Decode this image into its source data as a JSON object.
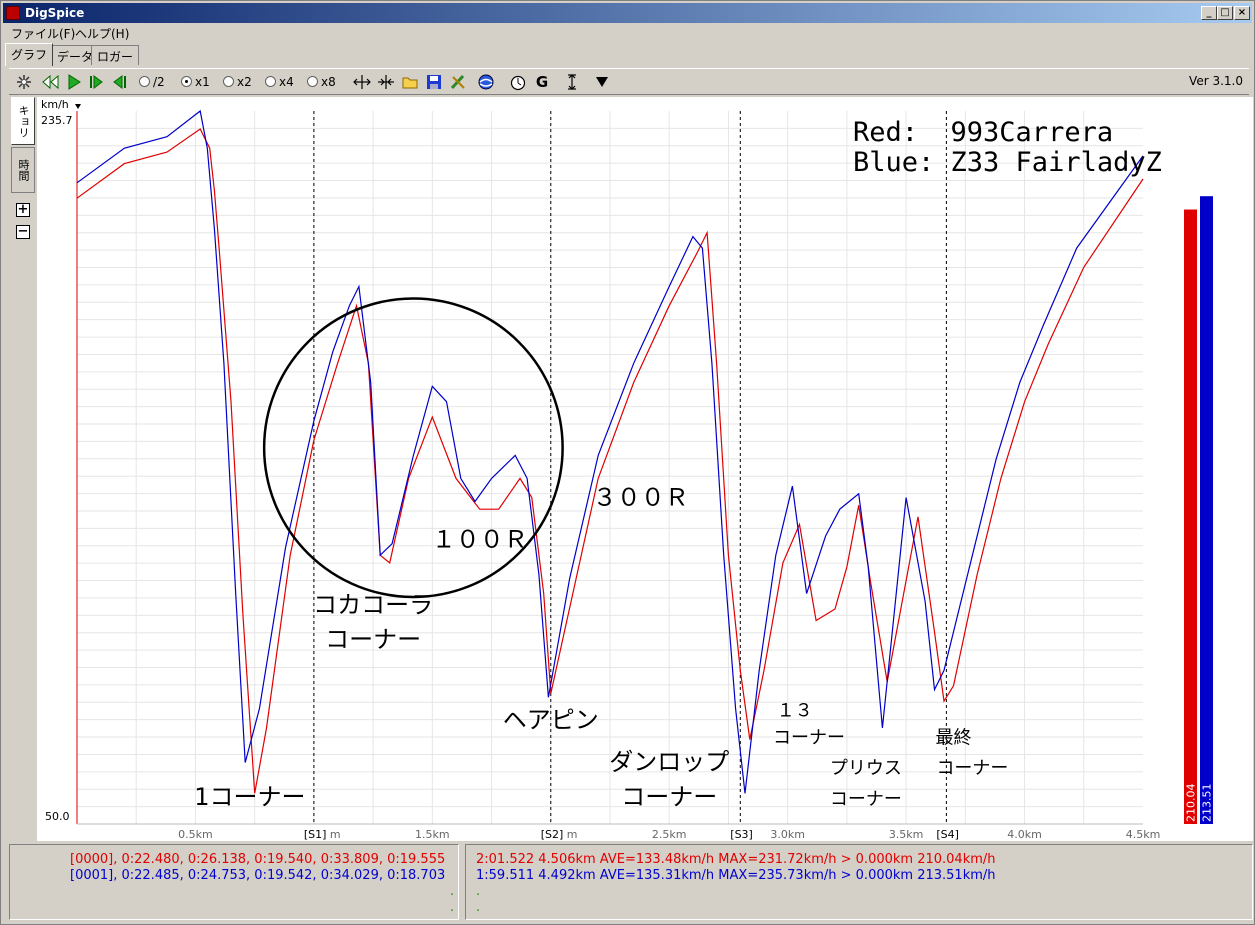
{
  "window": {
    "title": "DigSpice",
    "minimize": "_",
    "maximize": "□",
    "close": "×"
  },
  "menu": [
    {
      "label": "ファイル(F)"
    },
    {
      "label": "ヘルプ(H)"
    }
  ],
  "tabs": [
    {
      "label": "グラフ"
    },
    {
      "label": "データ"
    },
    {
      "label": "ロガー"
    }
  ],
  "toolbar": {
    "speeds": [
      {
        "label": "/2",
        "selected": false
      },
      {
        "label": "x1",
        "selected": true
      },
      {
        "label": "x2",
        "selected": false
      },
      {
        "label": "x4",
        "selected": false
      },
      {
        "label": "x8",
        "selected": false
      }
    ],
    "g_label": "G",
    "version": "Ver 3.1.0"
  },
  "side_tabs": [
    {
      "label": "キョリ"
    },
    {
      "label": "時間"
    }
  ],
  "colors": {
    "red": "#e00000",
    "blue": "#0000c8",
    "accent": "#0a246a"
  },
  "chart_data": {
    "type": "line",
    "ylabel": "km/h",
    "ymax_label": "235.7",
    "ymin_label": "50.0",
    "ylim": [
      50.0,
      235.7
    ],
    "xlim": [
      0,
      4.5
    ],
    "x_unit": "km",
    "x_ticks": [
      {
        "x": 0.5,
        "label": "0.5km"
      },
      {
        "x": 1.5,
        "label": "1.5km"
      },
      {
        "x": 2.5,
        "label": "2.5km"
      },
      {
        "x": 3.0,
        "label": "3.0km"
      },
      {
        "x": 3.5,
        "label": "3.5km"
      },
      {
        "x": 4.0,
        "label": "4.0km"
      },
      {
        "x": 4.5,
        "label": "4.5km"
      }
    ],
    "sectors": [
      {
        "x": 1.0,
        "label": "[S1]",
        "unit": "m"
      },
      {
        "x": 2.0,
        "label": "[S2]",
        "unit": "m"
      },
      {
        "x": 2.8,
        "label": "[S3]",
        "unit": ""
      },
      {
        "x": 3.67,
        "label": "[S4]",
        "unit": ""
      }
    ],
    "legend": [
      "Red:  993Carrera",
      "Blue: Z33 FairladyZ"
    ],
    "annotations": [
      {
        "text": "1コーナー",
        "x": 0.73,
        "y": 55
      },
      {
        "text": "コカコーラ",
        "x": 1.25,
        "y": 105
      },
      {
        "text": "コーナー",
        "x": 1.25,
        "y": 96
      },
      {
        "text": "１００Ｒ",
        "x": 1.7,
        "y": 122
      },
      {
        "text": "３００Ｒ",
        "x": 2.38,
        "y": 133
      },
      {
        "text": "ヘアピン",
        "x": 2.0,
        "y": 75
      },
      {
        "text": "ダンロップ",
        "x": 2.5,
        "y": 64
      },
      {
        "text": "コーナー",
        "x": 2.5,
        "y": 55
      },
      {
        "text": "１３",
        "x": 3.03,
        "y": 78
      },
      {
        "text": "コーナー",
        "x": 3.09,
        "y": 71
      },
      {
        "text": "プリウス",
        "x": 3.33,
        "y": 63
      },
      {
        "text": "コーナー",
        "x": 3.33,
        "y": 55
      },
      {
        "text": "最終",
        "x": 3.7,
        "y": 71
      },
      {
        "text": "コーナー",
        "x": 3.78,
        "y": 63
      }
    ],
    "highlight_circle": {
      "cx": 1.42,
      "cy": 148,
      "r_km": 0.63
    },
    "series": [
      {
        "name": "Red:  993Carrera",
        "color": "#e00000",
        "bar_label": "210.04",
        "bar_value": 210.04,
        "points": [
          [
            0,
            213
          ],
          [
            0.2,
            222
          ],
          [
            0.38,
            225
          ],
          [
            0.52,
            231
          ],
          [
            0.56,
            226
          ],
          [
            0.58,
            215
          ],
          [
            0.6,
            200
          ],
          [
            0.65,
            160
          ],
          [
            0.7,
            105
          ],
          [
            0.75,
            58
          ],
          [
            0.8,
            75
          ],
          [
            0.9,
            120
          ],
          [
            1.0,
            150
          ],
          [
            1.1,
            170
          ],
          [
            1.18,
            185
          ],
          [
            1.23,
            170
          ],
          [
            1.28,
            120
          ],
          [
            1.32,
            118
          ],
          [
            1.4,
            140
          ],
          [
            1.5,
            156
          ],
          [
            1.6,
            140
          ],
          [
            1.7,
            132
          ],
          [
            1.78,
            132
          ],
          [
            1.87,
            140
          ],
          [
            1.92,
            135
          ],
          [
            1.97,
            110
          ],
          [
            2.0,
            84
          ],
          [
            2.1,
            112
          ],
          [
            2.2,
            140
          ],
          [
            2.35,
            165
          ],
          [
            2.5,
            185
          ],
          [
            2.62,
            199
          ],
          [
            2.66,
            204
          ],
          [
            2.7,
            170
          ],
          [
            2.75,
            120
          ],
          [
            2.8,
            90
          ],
          [
            2.84,
            72
          ],
          [
            2.9,
            90
          ],
          [
            2.98,
            118
          ],
          [
            3.05,
            128
          ],
          [
            3.12,
            103
          ],
          [
            3.2,
            106
          ],
          [
            3.25,
            117
          ],
          [
            3.3,
            133
          ],
          [
            3.35,
            113
          ],
          [
            3.42,
            87
          ],
          [
            3.55,
            130
          ],
          [
            3.62,
            100
          ],
          [
            3.66,
            82
          ],
          [
            3.7,
            86
          ],
          [
            3.8,
            115
          ],
          [
            3.9,
            140
          ],
          [
            4.0,
            160
          ],
          [
            4.1,
            175
          ],
          [
            4.25,
            195
          ],
          [
            4.5,
            218
          ]
        ]
      },
      {
        "name": "Blue: Z33 FairladyZ",
        "color": "#0000c8",
        "bar_label": "213.51",
        "bar_value": 213.51,
        "points": [
          [
            0,
            217
          ],
          [
            0.2,
            226
          ],
          [
            0.38,
            229
          ],
          [
            0.52,
            235.7
          ],
          [
            0.55,
            226
          ],
          [
            0.58,
            205
          ],
          [
            0.62,
            170
          ],
          [
            0.67,
            110
          ],
          [
            0.71,
            66
          ],
          [
            0.77,
            80
          ],
          [
            0.88,
            122
          ],
          [
            1.0,
            155
          ],
          [
            1.08,
            173
          ],
          [
            1.15,
            185
          ],
          [
            1.19,
            190
          ],
          [
            1.24,
            165
          ],
          [
            1.28,
            120
          ],
          [
            1.33,
            123
          ],
          [
            1.42,
            146
          ],
          [
            1.5,
            164
          ],
          [
            1.56,
            160
          ],
          [
            1.62,
            140
          ],
          [
            1.68,
            134
          ],
          [
            1.75,
            140
          ],
          [
            1.85,
            146
          ],
          [
            1.9,
            140
          ],
          [
            1.95,
            115
          ],
          [
            1.99,
            83
          ],
          [
            2.08,
            114
          ],
          [
            2.2,
            146
          ],
          [
            2.35,
            170
          ],
          [
            2.5,
            190
          ],
          [
            2.6,
            203
          ],
          [
            2.64,
            200
          ],
          [
            2.68,
            170
          ],
          [
            2.73,
            120
          ],
          [
            2.78,
            80
          ],
          [
            2.82,
            58
          ],
          [
            2.88,
            90
          ],
          [
            2.95,
            120
          ],
          [
            3.02,
            138
          ],
          [
            3.08,
            110
          ],
          [
            3.16,
            125
          ],
          [
            3.22,
            132
          ],
          [
            3.3,
            136
          ],
          [
            3.34,
            117
          ],
          [
            3.4,
            75
          ],
          [
            3.5,
            135
          ],
          [
            3.58,
            108
          ],
          [
            3.62,
            85
          ],
          [
            3.66,
            90
          ],
          [
            3.78,
            120
          ],
          [
            3.88,
            145
          ],
          [
            3.98,
            165
          ],
          [
            4.08,
            180
          ],
          [
            4.22,
            200
          ],
          [
            4.5,
            224
          ]
        ]
      }
    ]
  },
  "status": {
    "left_lines": [
      "[0000], 0:22.480, 0:26.138, 0:19.540, 0:33.809, 0:19.555",
      "[0001], 0:22.485, 0:24.753, 0:19.542, 0:34.029, 0:18.703"
    ],
    "right_lines": [
      "2:01.522 4.506km AVE=133.48km/h MAX=231.72km/h > 0.000km 210.04km/h",
      "1:59.511 4.492km AVE=135.31km/h MAX=235.73km/h > 0.000km 213.51km/h"
    ],
    "dot": "."
  }
}
